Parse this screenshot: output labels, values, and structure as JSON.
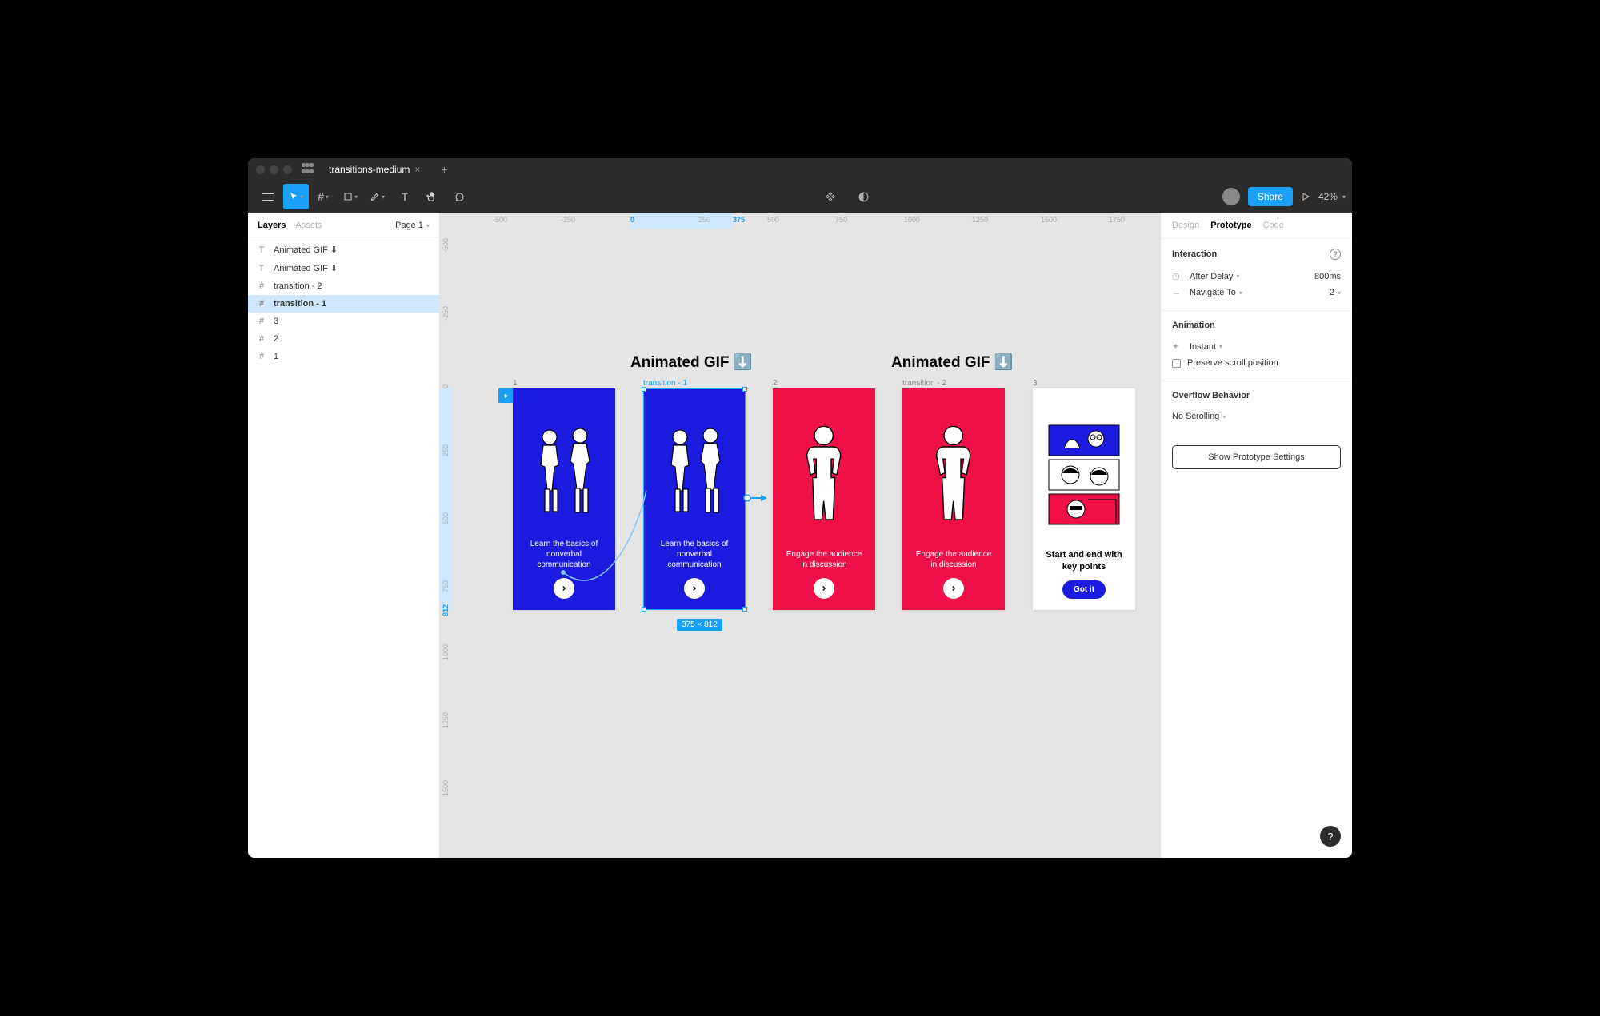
{
  "titlebar": {
    "tab_name": "transitions-medium"
  },
  "toolbar": {
    "zoom": "42%",
    "share": "Share"
  },
  "left_panel": {
    "tab_layers": "Layers",
    "tab_assets": "Assets",
    "page": "Page 1",
    "layers": [
      {
        "icon": "T",
        "name": "Animated GIF ⬇"
      },
      {
        "icon": "T",
        "name": "Animated GIF ⬇"
      },
      {
        "icon": "#",
        "name": "transition - 2"
      },
      {
        "icon": "#",
        "name": "transition - 1",
        "selected": true
      },
      {
        "icon": "#",
        "name": "3"
      },
      {
        "icon": "#",
        "name": "2"
      },
      {
        "icon": "#",
        "name": "1"
      }
    ]
  },
  "canvas": {
    "ruler_top": [
      "-500",
      "-250",
      "0",
      "250",
      "375",
      "500",
      "750",
      "1000",
      "1250",
      "1500",
      "1750"
    ],
    "ruler_left": [
      "-500",
      "-250",
      "0",
      "250",
      "500",
      "750",
      "1000",
      "1250",
      "1500"
    ],
    "ruler_left_hl": "812",
    "title1": "Animated GIF ⬇️",
    "title2": "Animated GIF ⬇️",
    "frames": {
      "f1": {
        "label": "1",
        "text": "Learn the basics of nonverbal communication"
      },
      "t1": {
        "label": "transition - 1",
        "text": "Learn the basics of nonverbal communication"
      },
      "f2": {
        "label": "2",
        "text": "Engage the audience in discussion"
      },
      "t2": {
        "label": "transition - 2",
        "text": "Engage the audience in discussion"
      },
      "f3": {
        "label": "3",
        "text": "Start and end with key points",
        "btn": "Got  it"
      }
    },
    "size_badge": "375 × 812"
  },
  "right_panel": {
    "tab_design": "Design",
    "tab_prototype": "Prototype",
    "tab_code": "Code",
    "interaction": {
      "heading": "Interaction",
      "trigger": "After Delay",
      "trigger_val": "800ms",
      "action": "Navigate To",
      "action_val": "2"
    },
    "animation": {
      "heading": "Animation",
      "type": "Instant",
      "preserve": "Preserve scroll position"
    },
    "overflow": {
      "heading": "Overflow Behavior",
      "value": "No Scrolling"
    },
    "proto_settings": "Show Prototype Settings"
  },
  "help": "?"
}
